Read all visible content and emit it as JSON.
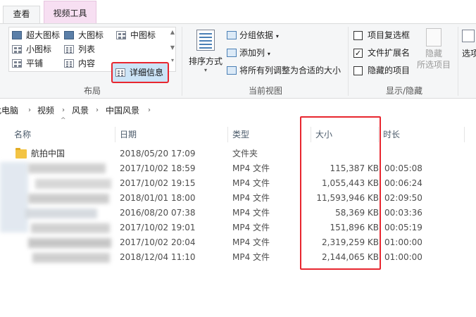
{
  "tabs": {
    "view": "查看",
    "video_tools": "视频工具"
  },
  "ribbon": {
    "layout": {
      "items": {
        "extra_large": "超大图标",
        "large": "大图标",
        "medium": "中图标",
        "small": "小图标",
        "list": "列表",
        "details": "详细信息",
        "tiles": "平铺",
        "content": "内容"
      },
      "label": "布局"
    },
    "current_view": {
      "sort_by": "排序方式",
      "group_by": "分组依据",
      "add_column": "添加列",
      "fit_columns": "将所有列调整为合适的大小",
      "label": "当前视图"
    },
    "show_hide": {
      "item_checkboxes": "项目复选框",
      "file_extensions": "文件扩展名",
      "hidden_items": "隐藏的项目",
      "hide_selected_1": "隐藏",
      "hide_selected_2": "所选项目",
      "label": "显示/隐藏",
      "file_extensions_checked": true,
      "options_partial": "选项"
    }
  },
  "breadcrumb": [
    "此电脑",
    "视频",
    "风景",
    "中国风景"
  ],
  "columns": {
    "name": "名称",
    "date": "日期",
    "type": "类型",
    "size": "大小",
    "duration": "时长"
  },
  "rows": [
    {
      "name": "航拍中国",
      "date": "2018/05/20 17:09",
      "type": "文件夹",
      "size": "",
      "duration": ""
    },
    {
      "name": "",
      "date": "2017/10/02 18:59",
      "type": "MP4 文件",
      "size": "115,387 KB",
      "duration": "00:05:08"
    },
    {
      "name": "",
      "date": "2017/10/02 19:15",
      "type": "MP4 文件",
      "size": "1,055,443 KB",
      "duration": "00:06:24"
    },
    {
      "name": "",
      "date": "2018/01/01 18:00",
      "type": "MP4 文件",
      "size": "11,593,946 KB",
      "duration": "02:09:50"
    },
    {
      "name": "",
      "date": "2016/08/20 07:38",
      "type": "MP4 文件",
      "size": "58,369 KB",
      "duration": "00:03:36"
    },
    {
      "name": "",
      "date": "2017/10/02 19:01",
      "type": "MP4 文件",
      "size": "151,896 KB",
      "duration": "00:05:19"
    },
    {
      "name": "",
      "date": "2017/10/02 20:04",
      "type": "MP4 文件",
      "size": "2,319,259 KB",
      "duration": "01:00:00"
    },
    {
      "name": "",
      "date": "2018/12/04 11:10",
      "type": "MP4 文件",
      "size": "2,144,065 KB",
      "duration": "01:00:00"
    }
  ],
  "colors": {
    "highlight": "#e8262f",
    "selected_bg": "#cce4f7",
    "video_tab": "#f7dff2"
  }
}
